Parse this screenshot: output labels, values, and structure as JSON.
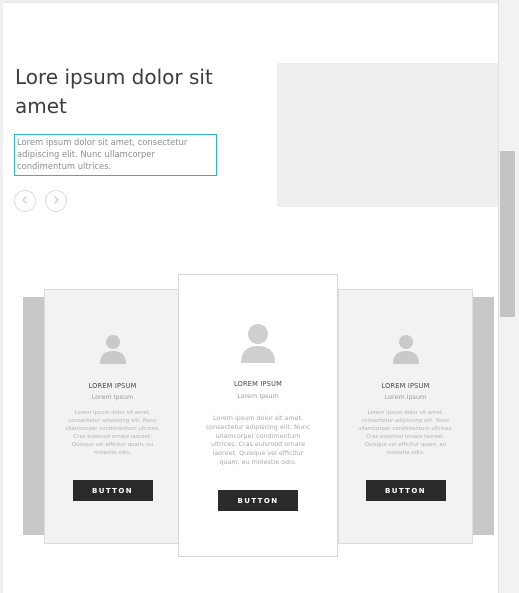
{
  "hero": {
    "title": "Lore ipsum dolor sit amet",
    "text": "Lorem ipsum dolor sit amet, consectetur adipiscing elit. Nunc ullamcorper condimentum ultrices."
  },
  "navigation": {
    "prev_icon": "chevron-left-icon",
    "next_icon": "chevron-right-icon"
  },
  "cards": [
    {
      "title": "LOREM IPSUM",
      "subtitle": "Lorem Ipsum",
      "body": "Lorem ipsum dolor sit amet, consectetur adipiscing elit. Nunc ullamcorper condimentum ultrices. Cras euismod ornare laoreet. Quisque vel efficitur quam, eu molestie odio.",
      "button": "BUTTON",
      "icon": "user-icon"
    },
    {
      "title": "LOREM IPSUM",
      "subtitle": "Lorem Ipsum",
      "body": "Lorem ipsum dolor sit amet, consectetur adipiscing elit. Nunc ullamcorper condimentum ultrices. Cras euismod ornare laoreet. Quisque vel efficitur quam, eu molestie odio.",
      "button": "BUTTON",
      "icon": "user-icon"
    },
    {
      "title": "LOREM IPSUM",
      "subtitle": "Lorem Ipsum",
      "body": "Lorem ipsum dolor sit amet, consectetur adipiscing elit. Nunc ullamcorper condimentum ultrices. Cras euismod ornare laoreet. Quisque vel efficitur quam, eu molestie odio.",
      "button": "BUTTON",
      "icon": "user-icon"
    }
  ],
  "colors": {
    "accent_border": "#2fb3c6",
    "button_bg": "#2a2a2a",
    "placeholder_gray": "#c8c8c8"
  }
}
